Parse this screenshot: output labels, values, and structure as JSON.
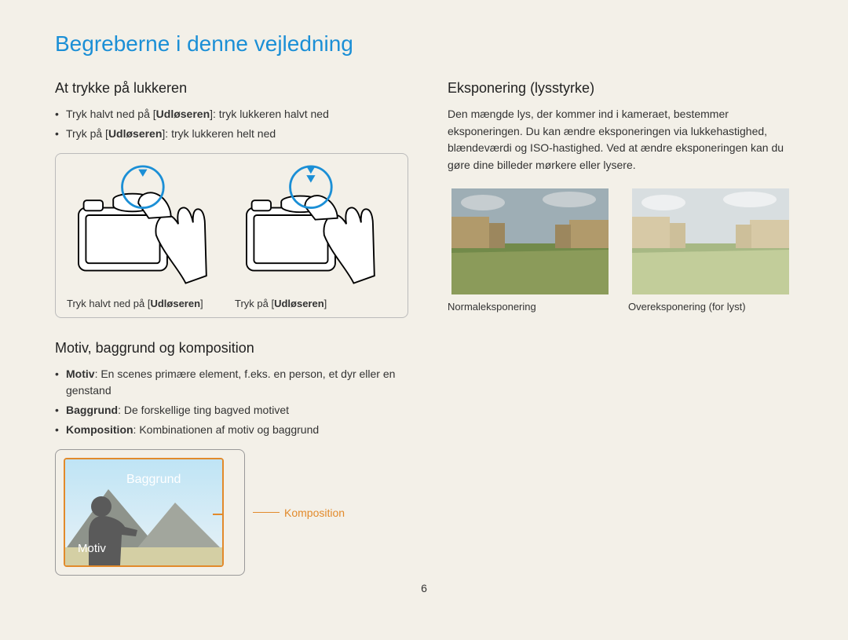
{
  "title": "Begreberne i denne vejledning",
  "pageNumber": "6",
  "left": {
    "shutter": {
      "heading": "At trykke på lukkeren",
      "bullets": [
        {
          "prefix": "Tryk halvt ned på [",
          "bold": "Udløseren",
          "suffix": "]: tryk lukkeren halvt ned"
        },
        {
          "prefix": "Tryk på [",
          "bold": "Udløseren",
          "suffix": "]: tryk lukkeren helt ned"
        }
      ],
      "captions": [
        {
          "prefix": "Tryk halvt ned på [",
          "bold": "Udløseren",
          "suffix": "]"
        },
        {
          "prefix": "Tryk på [",
          "bold": "Udløseren",
          "suffix": "]"
        }
      ]
    },
    "composition": {
      "heading": "Motiv, baggrund og komposition",
      "bullets": [
        {
          "bold": "Motiv",
          "text": ": En scenes primære element, f.eks. en person, et dyr eller en genstand"
        },
        {
          "bold": "Baggrund",
          "text": ": De forskellige ting bagved motivet"
        },
        {
          "bold": "Komposition",
          "text": ": Kombinationen af motiv og baggrund"
        }
      ],
      "labels": {
        "background": "Baggrund",
        "subject": "Motiv",
        "composition": "Komposition"
      }
    }
  },
  "right": {
    "exposure": {
      "heading": "Eksponering (lysstyrke)",
      "paragraph": "Den mængde lys, der kommer ind i kameraet, bestemmer eksponeringen. Du kan ændre eksponeringen via lukkehastighed, blændeværdi og ISO-hastighed. Ved at ændre eksponeringen kan du gøre dine billeder mørkere eller lysere.",
      "captions": {
        "normal": "Normaleksponering",
        "over": "Overeksponering (for lyst)"
      }
    }
  }
}
